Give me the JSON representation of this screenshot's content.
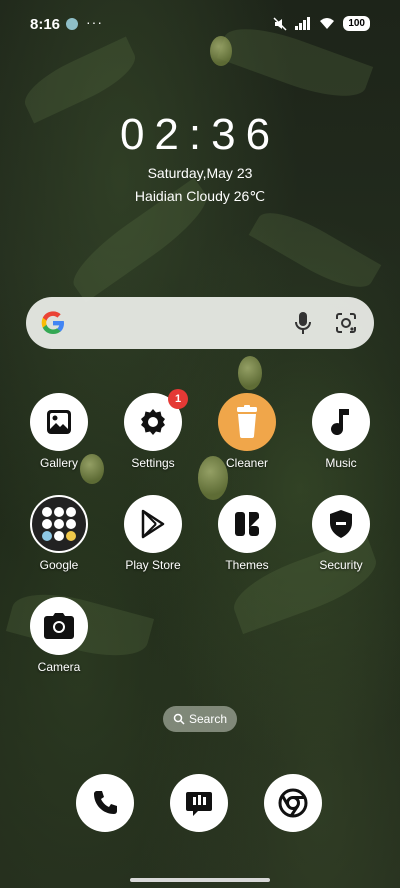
{
  "status_bar": {
    "time": "8:16",
    "more": "···",
    "battery": "100"
  },
  "lockclock": {
    "time": "02:36",
    "date": "Saturday,May 23",
    "weather": "Haidian Cloudy 26℃"
  },
  "search_bar": {
    "logo": "G"
  },
  "apps": [
    {
      "label": "Gallery"
    },
    {
      "label": "Settings",
      "badge": "1"
    },
    {
      "label": "Cleaner"
    },
    {
      "label": "Music"
    },
    {
      "label": "Google"
    },
    {
      "label": "Play Store"
    },
    {
      "label": "Themes"
    },
    {
      "label": "Security"
    },
    {
      "label": "Camera"
    }
  ],
  "search_pill": {
    "label": "Search"
  },
  "dock": [
    {
      "icon": "phone-icon"
    },
    {
      "icon": "messages-icon"
    },
    {
      "icon": "chrome-icon"
    }
  ],
  "colors": {
    "badge": "#e53935",
    "cleaner": "#f0a64a"
  }
}
